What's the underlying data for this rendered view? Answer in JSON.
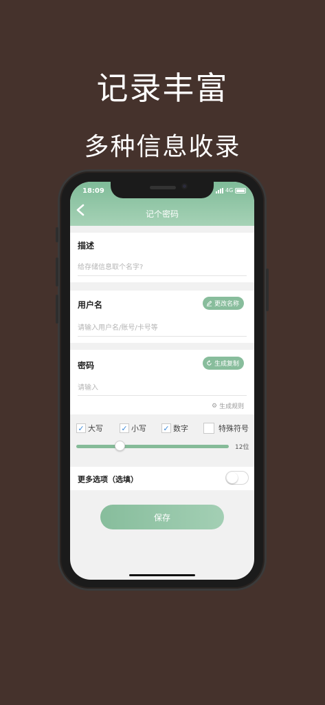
{
  "promo": {
    "headline": "记录丰富",
    "subheadline": "多种信息收录"
  },
  "status_bar": {
    "time": "18:09",
    "network": "4G"
  },
  "header": {
    "back_icon": "chevron-left-icon",
    "title": "记个密码"
  },
  "description": {
    "label": "描述",
    "placeholder": "给存储信息取个名字?"
  },
  "username": {
    "label": "用户名",
    "placeholder": "请输入用户名/账号/卡号等",
    "rename_button": "更改名称",
    "rename_icon": "edit-icon"
  },
  "password": {
    "label": "密码",
    "placeholder": "请输入",
    "generate_button": "生成复制",
    "generate_icon": "refresh-icon",
    "rules_link": "生成规则",
    "rules_icon": "gear-icon"
  },
  "options": {
    "uppercase": {
      "label": "大写",
      "checked": true
    },
    "lowercase": {
      "label": "小写",
      "checked": true
    },
    "digits": {
      "label": "数字",
      "checked": true
    },
    "symbols": {
      "label": "特殊符号",
      "checked": false
    },
    "length_label": "12位",
    "length_value": 12
  },
  "more_options": {
    "label": "更多选项（选填）",
    "enabled": false
  },
  "save_label": "保存",
  "colors": {
    "background": "#45322c",
    "accent": "#88bd9c",
    "check": "#3d89d8"
  }
}
